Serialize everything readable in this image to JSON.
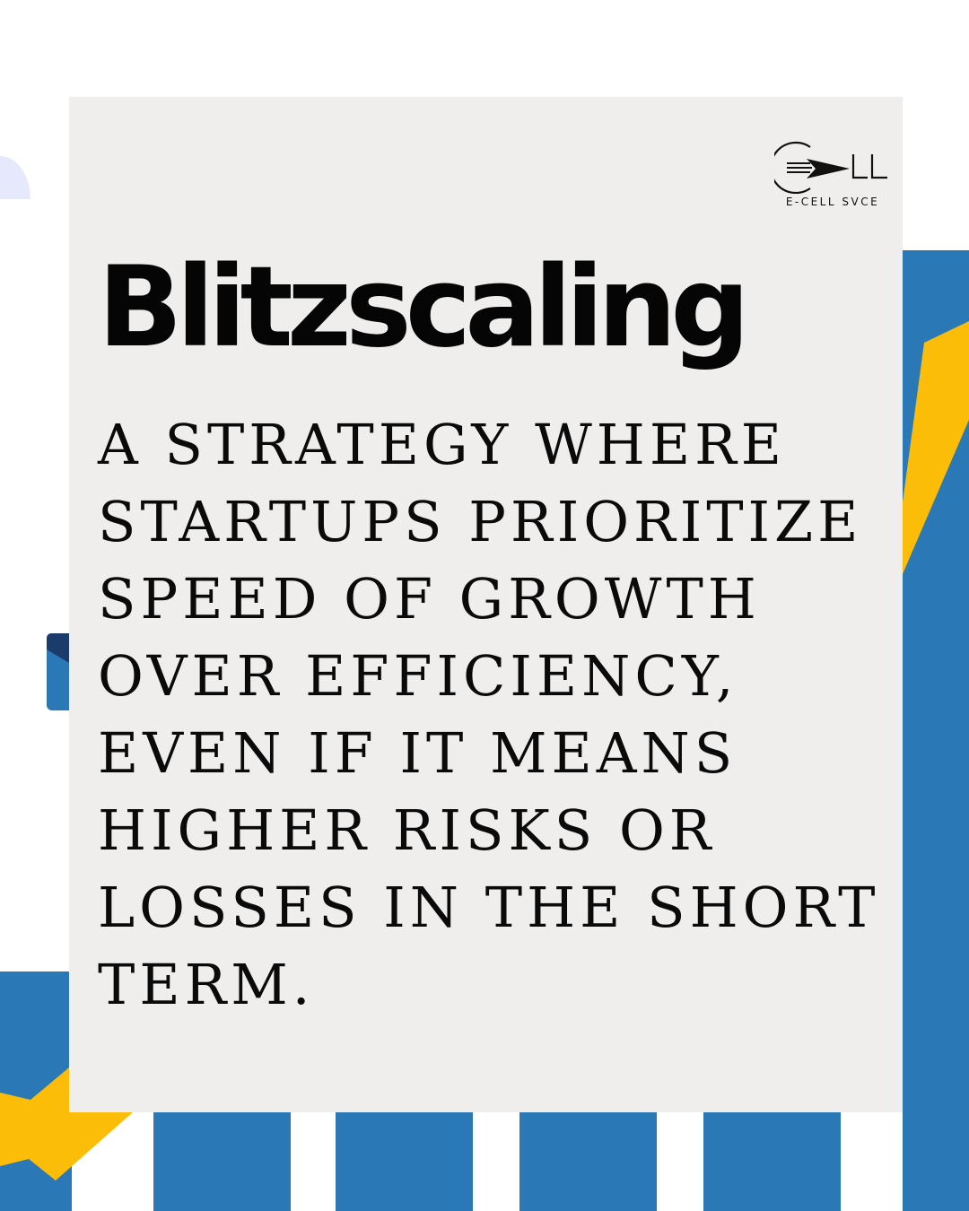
{
  "logo": {
    "caption": "E-CELL SVCE"
  },
  "title": "Blitzscaling",
  "description_lines": [
    "A STRATEGY WHERE",
    "STARTUPS PRIORITIZE",
    "SPEED OF GROWTH",
    "OVER EFFICIENCY,",
    "EVEN IF IT MEANS",
    "HIGHER RISKS OR",
    "LOSSES IN THE SHORT",
    "TERM."
  ],
  "colors": {
    "blue": "#2a78b6",
    "yellow": "#fbbd08",
    "lavender": "#e6e9fb",
    "navy": "#1b3c6b",
    "card": "#efeeed",
    "text": "#050505"
  }
}
